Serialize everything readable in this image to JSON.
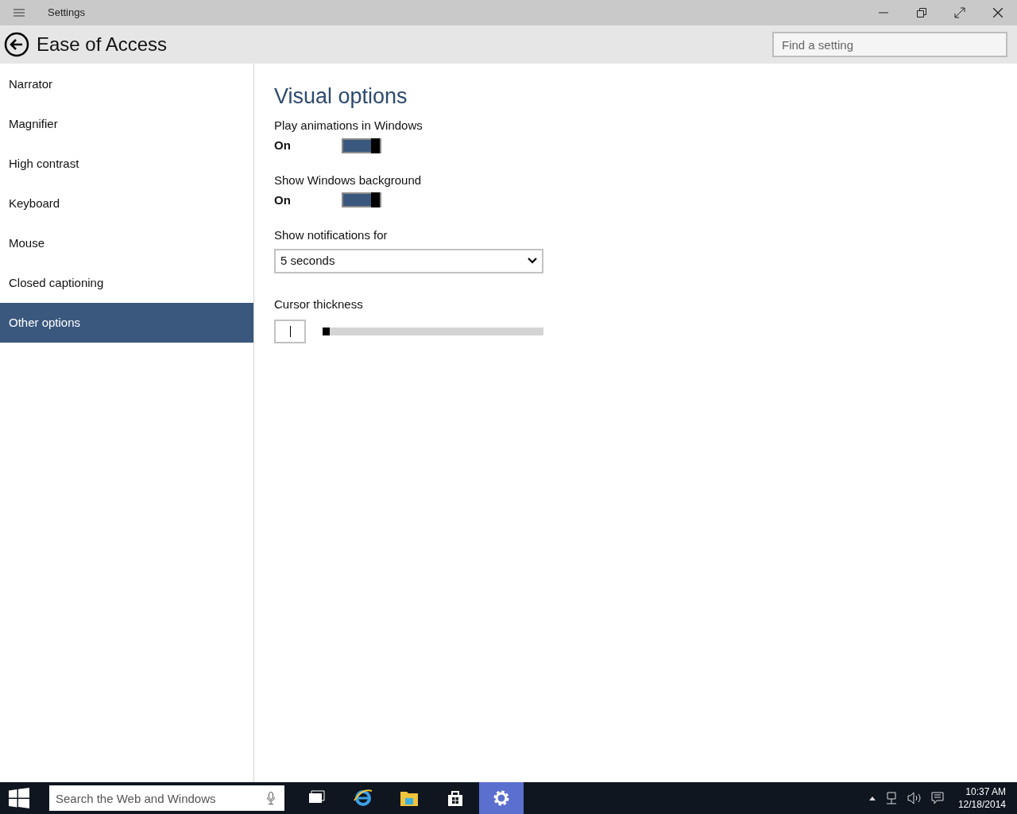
{
  "window": {
    "title": "Settings"
  },
  "header": {
    "title": "Ease of Access",
    "search": {
      "placeholder": "Find a setting"
    }
  },
  "sidebar": {
    "items": [
      {
        "label": "Narrator",
        "selected": false
      },
      {
        "label": "Magnifier",
        "selected": false
      },
      {
        "label": "High contrast",
        "selected": false
      },
      {
        "label": "Keyboard",
        "selected": false
      },
      {
        "label": "Mouse",
        "selected": false
      },
      {
        "label": "Closed captioning",
        "selected": false
      },
      {
        "label": "Other options",
        "selected": true
      }
    ]
  },
  "content": {
    "heading": "Visual options",
    "toggles": [
      {
        "label": "Play animations in Windows",
        "state_text": "On",
        "on": true
      },
      {
        "label": "Show Windows background",
        "state_text": "On",
        "on": true
      }
    ],
    "notifications": {
      "label": "Show notifications for",
      "value": "5 seconds"
    },
    "cursor": {
      "label": "Cursor thickness",
      "level": 0
    }
  },
  "taskbar": {
    "search": {
      "placeholder": "Search the Web and Windows"
    },
    "apps": [
      {
        "kind": "taskview",
        "selected": false
      },
      {
        "kind": "browser",
        "selected": false
      },
      {
        "kind": "folder",
        "selected": false
      },
      {
        "kind": "store",
        "selected": false
      },
      {
        "kind": "settings",
        "selected": true
      }
    ],
    "time": "10:37 AM",
    "date": "12/18/2014"
  }
}
